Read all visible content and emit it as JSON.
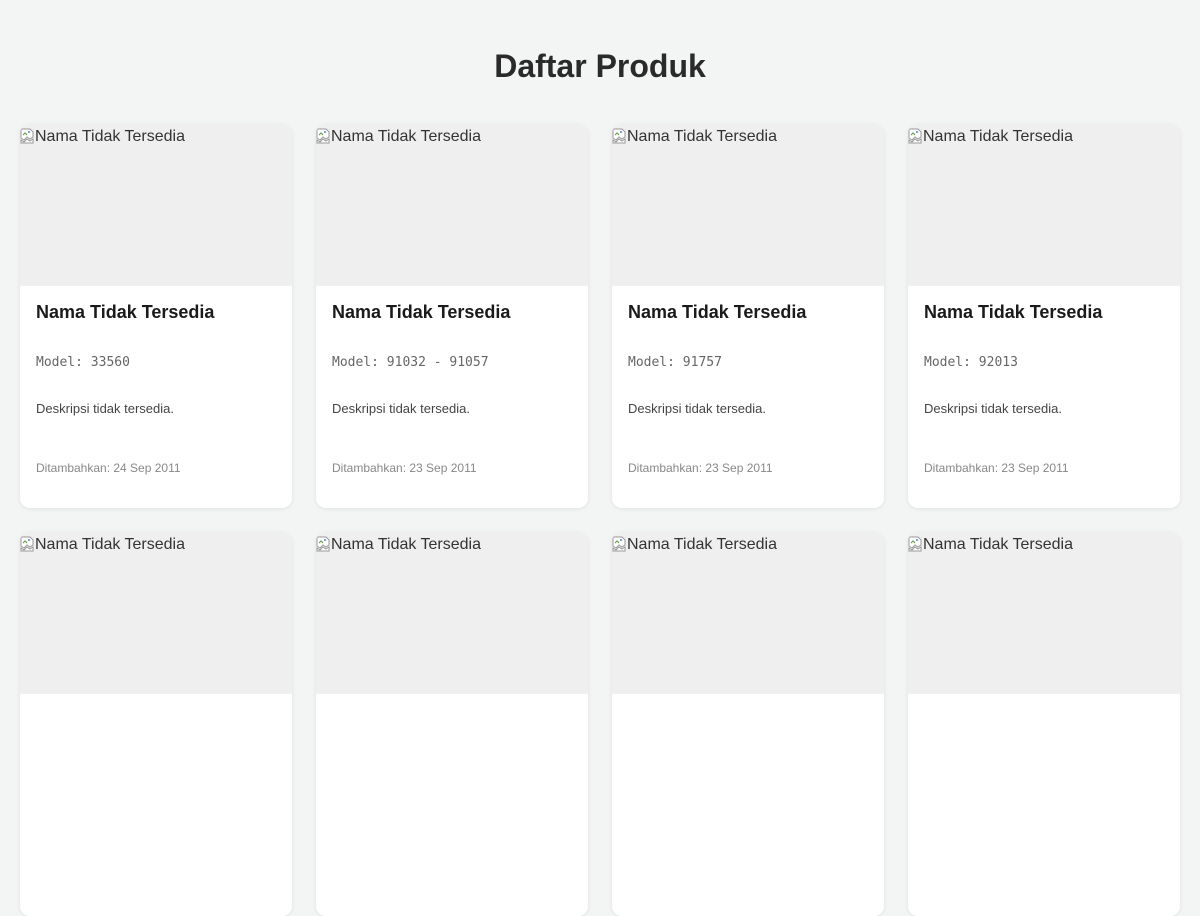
{
  "page": {
    "title": "Daftar Produk"
  },
  "products": [
    {
      "image_alt": "Nama Tidak Tersedia",
      "name": "Nama Tidak Tersedia",
      "model": "Model: 33560",
      "description": "Deskripsi tidak tersedia.",
      "date_added": "Ditambahkan: 24 Sep 2011"
    },
    {
      "image_alt": "Nama Tidak Tersedia",
      "name": "Nama Tidak Tersedia",
      "model": "Model: 91032 - 91057",
      "description": "Deskripsi tidak tersedia.",
      "date_added": "Ditambahkan: 23 Sep 2011"
    },
    {
      "image_alt": "Nama Tidak Tersedia",
      "name": "Nama Tidak Tersedia",
      "model": "Model: 91757",
      "description": "Deskripsi tidak tersedia.",
      "date_added": "Ditambahkan: 23 Sep 2011"
    },
    {
      "image_alt": "Nama Tidak Tersedia",
      "name": "Nama Tidak Tersedia",
      "model": "Model: 92013",
      "description": "Deskripsi tidak tersedia.",
      "date_added": "Ditambahkan: 23 Sep 2011"
    },
    {
      "image_alt": "Nama Tidak Tersedia"
    },
    {
      "image_alt": "Nama Tidak Tersedia"
    },
    {
      "image_alt": "Nama Tidak Tersedia"
    },
    {
      "image_alt": "Nama Tidak Tersedia"
    }
  ],
  "icons": {
    "broken_image": "broken-image-icon"
  },
  "colors": {
    "background": "#f3f4f4",
    "card": "#ffffff",
    "image_placeholder": "#efefef"
  }
}
